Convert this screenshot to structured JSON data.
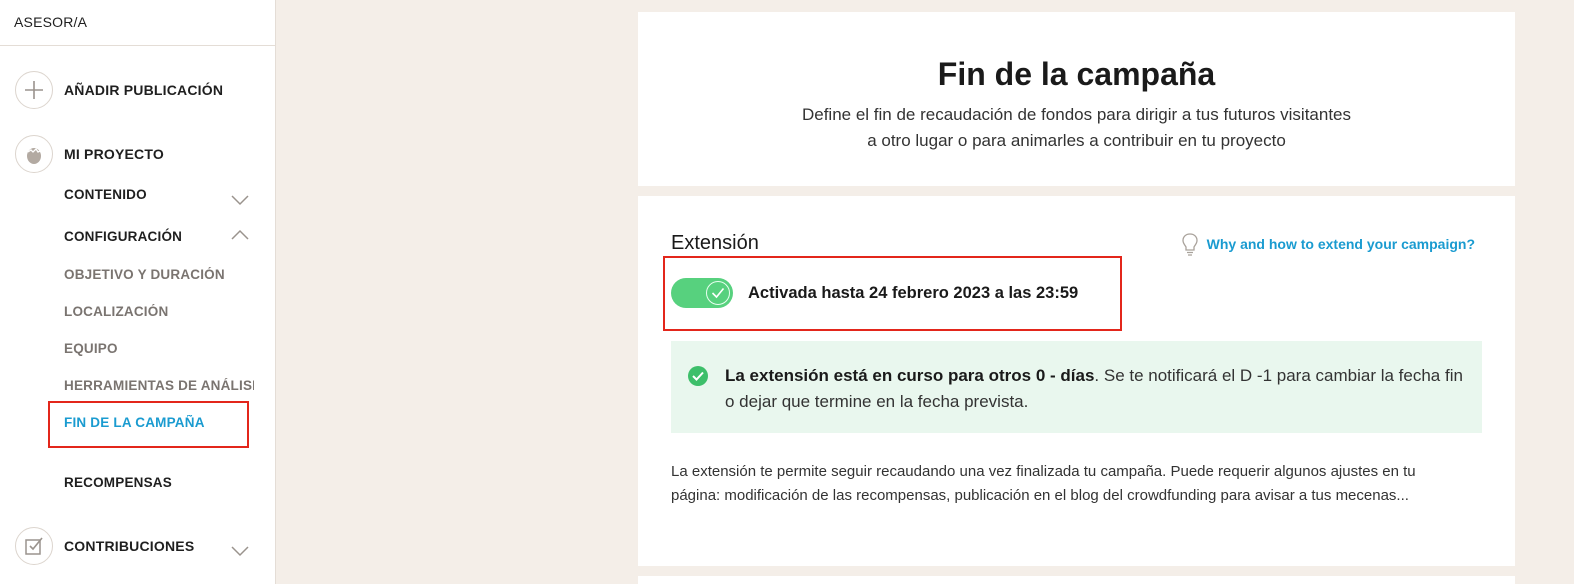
{
  "sidebar": {
    "header": "ASESOR/A",
    "add_publication": "AÑADIR PUBLICACIÓN",
    "my_project": "MI PROYECTO",
    "content": "CONTENIDO",
    "configuration": "CONFIGURACIÓN",
    "config_items": [
      "OBJETIVO Y DURACIÓN",
      "LOCALIZACIÓN",
      "EQUIPO",
      "HERRAMIENTAS DE ANÁLISIS",
      "FIN DE LA CAMPAÑA"
    ],
    "rewards": "RECOMPENSAS",
    "contributions": "CONTRIBUCIONES"
  },
  "main": {
    "title": "Fin de la campaña",
    "description": "Define el fin de recaudación de fondos para dirigir a tus futuros visitantes a otro lugar o para animarles a contribuir en tu proyecto",
    "section_title": "Extensión",
    "help_link": "Why and how to extend your campaign?",
    "toggle_label": "Activada hasta 24 febrero 2023 a las 23:59",
    "toggle_on": true,
    "notice_bold": "La extensión está en curso para otros 0 - días",
    "notice_rest": ". Se te notificará el D -1 para cambiar la fecha fin o dejar que termine en la fecha prevista.",
    "body_text": "La extensión te permite seguir recaudando una vez finalizada tu campaña. Puede requerir algunos ajustes en tu página: modificación de las recompensas, publicación en el blog del crowdfunding para avisar a tus mecenas..."
  },
  "colors": {
    "accent": "#1a9bd0",
    "toggle_on": "#57d17e",
    "highlight": "#e3261b",
    "notice_bg": "#e9f7ee",
    "page_bg": "#f4eee8"
  },
  "icons": [
    "plus-icon",
    "egg-icon",
    "checkbox-icon",
    "chevron-down-icon",
    "chevron-up-icon",
    "lightbulb-icon",
    "check-icon",
    "check-circle-icon"
  ]
}
